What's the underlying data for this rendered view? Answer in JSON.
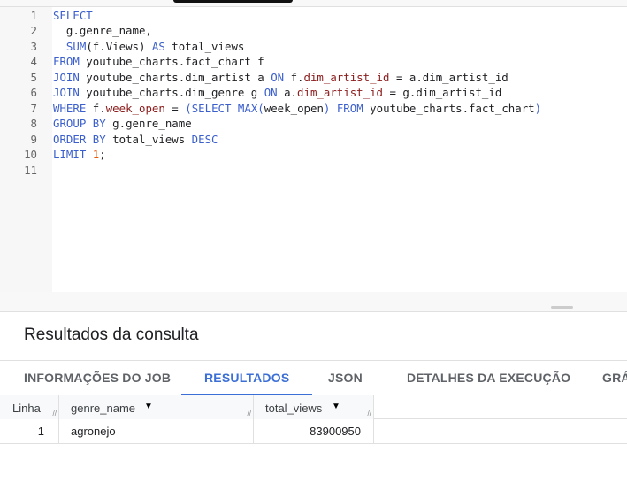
{
  "editor": {
    "lines": [
      [
        [
          "kw",
          "SELECT"
        ]
      ],
      [
        [
          "t",
          "  g.genre_name,"
        ]
      ],
      [
        [
          "t",
          "  "
        ],
        [
          "fn",
          "SUM"
        ],
        [
          "t",
          "(f.Views) "
        ],
        [
          "kw",
          "AS"
        ],
        [
          "t",
          " total_views"
        ]
      ],
      [
        [
          "kw",
          "FROM"
        ],
        [
          "t",
          " youtube_charts.fact_chart f"
        ]
      ],
      [
        [
          "kw",
          "JOIN"
        ],
        [
          "t",
          " youtube_charts.dim_artist a "
        ],
        [
          "kw",
          "ON"
        ],
        [
          "t",
          " f."
        ],
        [
          "col",
          "dim_artist_id"
        ],
        [
          "t",
          " = a.dim_artist_id"
        ]
      ],
      [
        [
          "kw",
          "JOIN"
        ],
        [
          "t",
          " youtube_charts.dim_genre g "
        ],
        [
          "kw",
          "ON"
        ],
        [
          "t",
          " a."
        ],
        [
          "col",
          "dim_artist_id"
        ],
        [
          "t",
          " = g.dim_artist_id"
        ]
      ],
      [
        [
          "kw",
          "WHERE"
        ],
        [
          "t",
          " f."
        ],
        [
          "col",
          "week_open"
        ],
        [
          "t",
          " = "
        ],
        [
          "kw",
          "(SELECT"
        ],
        [
          "t",
          " "
        ],
        [
          "fn",
          "MAX("
        ],
        [
          "t",
          "week_open"
        ],
        [
          "fn",
          ")"
        ],
        [
          "t",
          " "
        ],
        [
          "kw",
          "FROM"
        ],
        [
          "t",
          " youtube_charts.fact_chart"
        ],
        [
          "kw",
          ")"
        ]
      ],
      [
        [
          "kw",
          "GROUP BY"
        ],
        [
          "t",
          " g.genre_name"
        ]
      ],
      [
        [
          "kw",
          "ORDER BY"
        ],
        [
          "t",
          " total_views "
        ],
        [
          "kw",
          "DESC"
        ]
      ],
      [
        [
          "kw",
          "LIMIT"
        ],
        [
          "t",
          " "
        ],
        [
          "num",
          "1"
        ],
        [
          "t",
          ";"
        ]
      ],
      []
    ]
  },
  "results": {
    "title": "Resultados da consulta",
    "tabs": [
      {
        "label": "INFORMAÇÕES DO JOB",
        "active": false
      },
      {
        "label": "RESULTADOS",
        "active": true
      },
      {
        "label": "JSON",
        "active": false
      },
      {
        "label": "DETALHES DA EXECUÇÃO",
        "active": false
      },
      {
        "label": "GRÁ",
        "active": false
      }
    ],
    "columns": [
      "Linha",
      "genre_name",
      "total_views"
    ],
    "rows": [
      [
        "1",
        "agronejo",
        "83900950"
      ]
    ]
  },
  "colors": {
    "accent": "#3b6fd6",
    "keyword": "#3b5fcc",
    "column": "#8b1a1a",
    "number": "#e8590c"
  }
}
